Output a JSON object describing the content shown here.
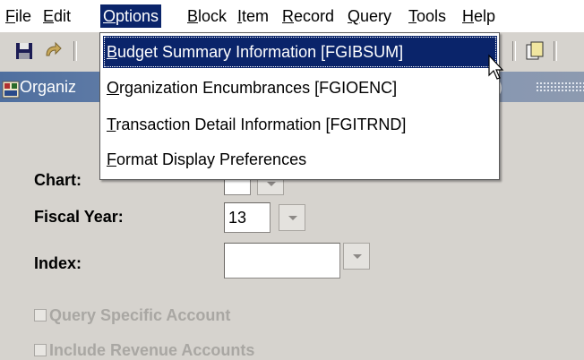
{
  "menubar": {
    "items": [
      {
        "label": "File",
        "ul": "F",
        "rest": "ile"
      },
      {
        "label": "Edit",
        "ul": "E",
        "rest": "dit"
      },
      {
        "label": "Options",
        "ul": "O",
        "rest": "ptions"
      },
      {
        "label": "Block",
        "ul": "B",
        "rest": "lock"
      },
      {
        "label": "Item",
        "ul": "I",
        "rest": "tem"
      },
      {
        "label": "Record",
        "ul": "R",
        "rest": "ecord"
      },
      {
        "label": "Query",
        "ul": "Q",
        "rest": "uery"
      },
      {
        "label": "Tools",
        "ul": "T",
        "rest": "ools"
      },
      {
        "label": "Help",
        "ul": "H",
        "rest": "elp"
      }
    ]
  },
  "window": {
    "title_left": "Organiz",
    "title_right": ")"
  },
  "dropdown": {
    "items": [
      {
        "ul": "B",
        "rest": "udget Summary Information [FGIBSUM]"
      },
      {
        "ul": "O",
        "rest": "rganization Encumbrances [FGIOENC]"
      },
      {
        "ul": "T",
        "rest": "ransaction Detail Information [FGITRND]"
      },
      {
        "ul": "F",
        "rest": "ormat Display Preferences"
      }
    ]
  },
  "form": {
    "chart_label": "Chart:",
    "chart_value": "",
    "fiscal_year_label": "Fiscal Year:",
    "fiscal_year_value": "13",
    "index_label": "Index:",
    "index_value": "",
    "query_specific_account": "Query Specific Account",
    "include_revenue_accounts": "Include Revenue Accounts"
  },
  "colors": {
    "menu_highlight": "#0a246a",
    "window_title": "#4f6f9f",
    "background": "#d6d3ce"
  }
}
